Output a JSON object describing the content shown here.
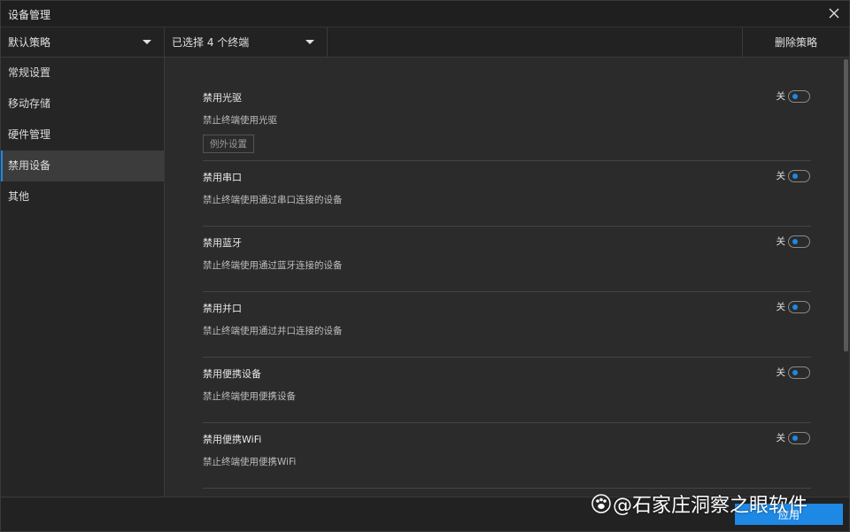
{
  "window": {
    "title": "设备管理"
  },
  "topbar": {
    "policy_dropdown": "默认策略",
    "terminal_dropdown": "已选择 4 个终端",
    "delete_policy": "删除策略"
  },
  "sidebar": {
    "items": [
      {
        "label": "常规设置"
      },
      {
        "label": "移动存储"
      },
      {
        "label": "硬件管理"
      },
      {
        "label": "禁用设备"
      },
      {
        "label": "其他"
      }
    ]
  },
  "settings": [
    {
      "name": "禁用光驱",
      "desc": "禁止终端使用光驱",
      "state": "关",
      "exception_button": "例外设置"
    },
    {
      "name": "禁用串口",
      "desc": "禁止终端使用通过串口连接的设备",
      "state": "关"
    },
    {
      "name": "禁用蓝牙",
      "desc": "禁止终端使用通过蓝牙连接的设备",
      "state": "关"
    },
    {
      "name": "禁用并口",
      "desc": "禁止终端使用通过并口连接的设备",
      "state": "关"
    },
    {
      "name": "禁用便携设备",
      "desc": "禁止终端使用便携设备",
      "state": "关"
    },
    {
      "name": "禁用便携WiFi",
      "desc": "禁止终端使用便携WiFi",
      "state": "关"
    }
  ],
  "footer": {
    "apply_label": "应用"
  },
  "watermark": {
    "text": "@石家庄洞察之眼软件"
  },
  "colors": {
    "accent": "#1e88e5",
    "background": "#2b2b2b",
    "sidebar_active": "#3c3c3c"
  }
}
